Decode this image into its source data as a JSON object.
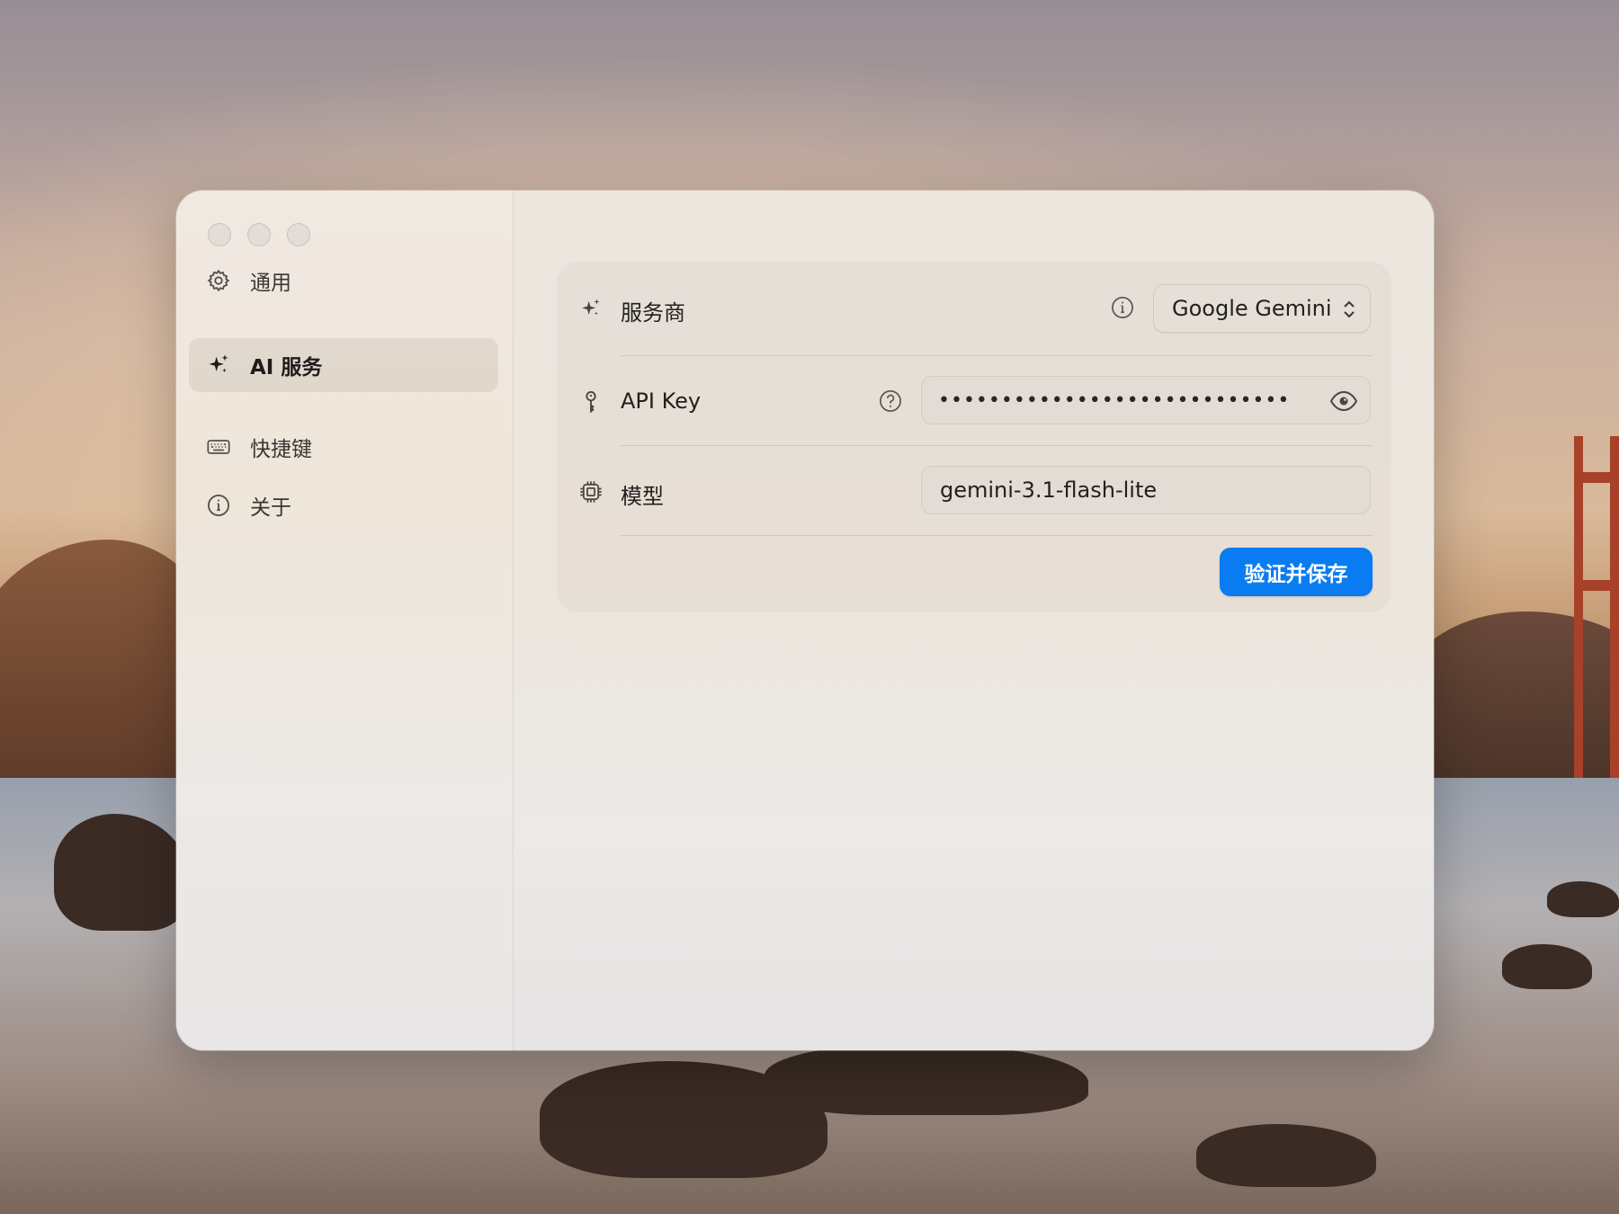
{
  "sidebar": {
    "items": [
      {
        "label": "通用",
        "icon": "gear-icon",
        "active": false
      },
      {
        "label": "AI 服务",
        "icon": "sparkle-icon",
        "active": true
      },
      {
        "label": "快捷键",
        "icon": "keyboard-icon",
        "active": false
      },
      {
        "label": "关于",
        "icon": "info-icon",
        "active": false
      }
    ]
  },
  "settings": {
    "provider": {
      "label": "服务商",
      "icon": "sparkle-icon",
      "value": "Google Gemini",
      "help_icon": "info-icon"
    },
    "api_key": {
      "label": "API Key",
      "icon": "key-icon",
      "value": "••••••••••••••••••••••••••••",
      "help_icon": "question-icon"
    },
    "model": {
      "label": "模型",
      "icon": "chip-icon",
      "value": "gemini-3.1-flash-lite"
    },
    "save_button": "验证并保存"
  },
  "colors": {
    "accent": "#0a7cf2",
    "sidebar_active_bg": "#e2dad0"
  }
}
